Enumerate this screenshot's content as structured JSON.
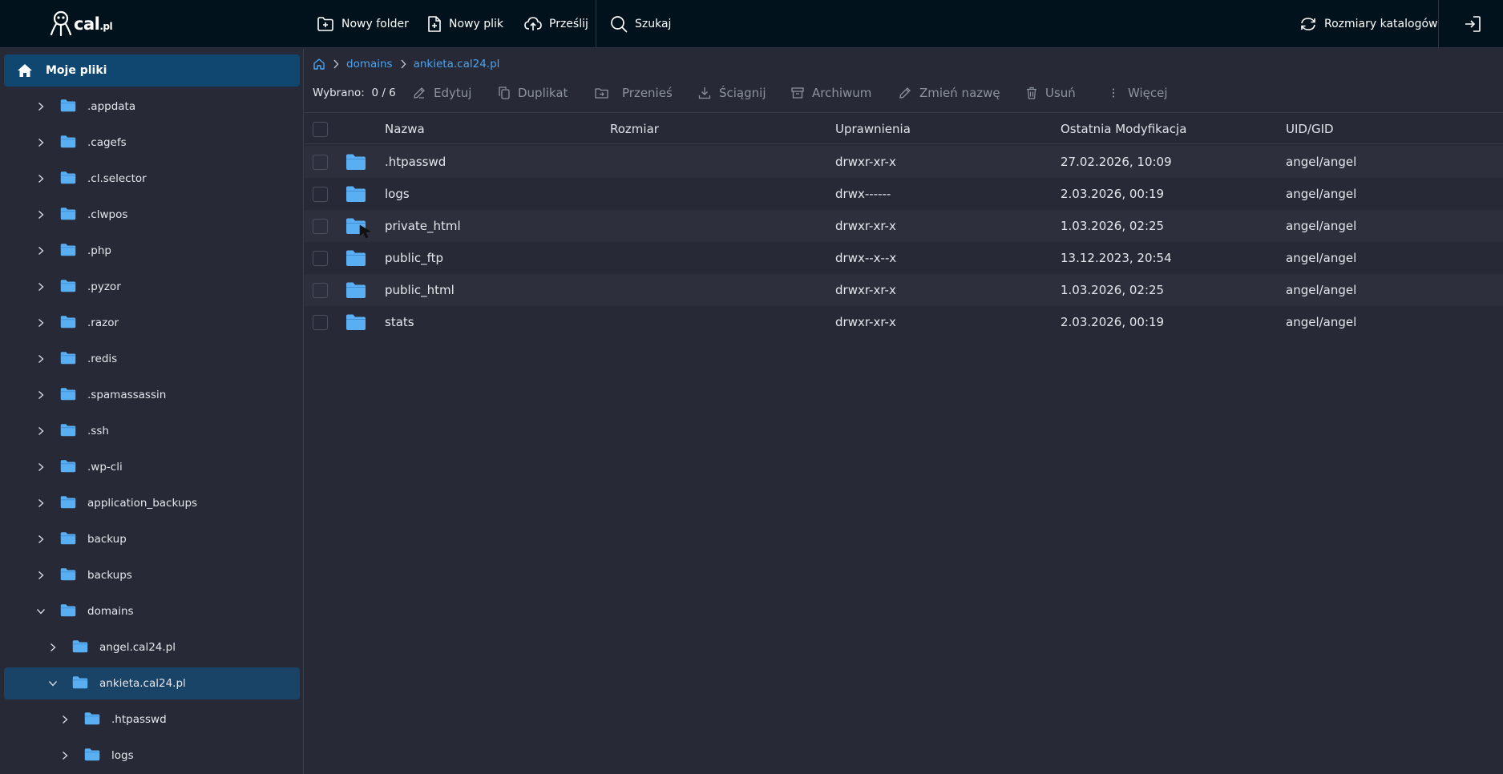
{
  "topbar": {
    "logo_text": "cal",
    "logo_suffix": ".pl",
    "new_folder": "Nowy folder",
    "new_file": "Nowy plik",
    "upload": "Prześlij",
    "search": "Szukaj",
    "dir_sizes": "Rozmiary katalogów"
  },
  "sidebar": {
    "root": "Moje pliki",
    "items": [
      {
        "label": ".appdata",
        "level": 0,
        "expanded": false
      },
      {
        "label": ".cagefs",
        "level": 0,
        "expanded": false
      },
      {
        "label": ".cl.selector",
        "level": 0,
        "expanded": false
      },
      {
        "label": ".clwpos",
        "level": 0,
        "expanded": false
      },
      {
        "label": ".php",
        "level": 0,
        "expanded": false
      },
      {
        "label": ".pyzor",
        "level": 0,
        "expanded": false
      },
      {
        "label": ".razor",
        "level": 0,
        "expanded": false
      },
      {
        "label": ".redis",
        "level": 0,
        "expanded": false
      },
      {
        "label": ".spamassassin",
        "level": 0,
        "expanded": false
      },
      {
        "label": ".ssh",
        "level": 0,
        "expanded": false
      },
      {
        "label": ".wp-cli",
        "level": 0,
        "expanded": false
      },
      {
        "label": "application_backups",
        "level": 0,
        "expanded": false
      },
      {
        "label": "backup",
        "level": 0,
        "expanded": false
      },
      {
        "label": "backups",
        "level": 0,
        "expanded": false
      },
      {
        "label": "domains",
        "level": 0,
        "expanded": true
      },
      {
        "label": "angel.cal24.pl",
        "level": 1,
        "expanded": false
      },
      {
        "label": "ankieta.cal24.pl",
        "level": 1,
        "expanded": true,
        "active": true
      },
      {
        "label": ".htpasswd",
        "level": 2,
        "expanded": false
      },
      {
        "label": "logs",
        "level": 2,
        "expanded": false
      }
    ]
  },
  "breadcrumb": [
    "domains",
    "ankieta.cal24.pl"
  ],
  "actions": {
    "selected_label": "Wybrano:",
    "selected_value": "0 / 6",
    "edit": "Edytuj",
    "duplicate": "Duplikat",
    "move": "Przenieś",
    "download": "Ściągnij",
    "archive": "Archiwum",
    "rename": "Zmień nazwę",
    "delete": "Usuń",
    "more": "Więcej"
  },
  "table": {
    "columns": [
      "Nazwa",
      "Rozmiar",
      "Uprawnienia",
      "Ostatnia Modyfikacja",
      "UID/GID"
    ],
    "rows": [
      {
        "name": ".htpasswd",
        "size": "",
        "perms": "drwxr-xr-x",
        "modified": "27.02.2026, 10:09",
        "uid": "angel/angel"
      },
      {
        "name": "logs",
        "size": "",
        "perms": "drwx------",
        "modified": "2.03.2026, 00:19",
        "uid": "angel/angel"
      },
      {
        "name": "private_html",
        "size": "",
        "perms": "drwxr-xr-x",
        "modified": "1.03.2026, 02:25",
        "uid": "angel/angel"
      },
      {
        "name": "public_ftp",
        "size": "",
        "perms": "drwx--x--x",
        "modified": "13.12.2023, 20:54",
        "uid": "angel/angel"
      },
      {
        "name": "public_html",
        "size": "",
        "perms": "drwxr-xr-x",
        "modified": "1.03.2026, 02:25",
        "uid": "angel/angel"
      },
      {
        "name": "stats",
        "size": "",
        "perms": "drwxr-xr-x",
        "modified": "2.03.2026, 00:19",
        "uid": "angel/angel"
      }
    ]
  },
  "colors": {
    "accent": "#4ba4f0",
    "folder": "#5aaef2",
    "topbar_bg": "#02121c",
    "active_bg": "#1a4368"
  },
  "icons": {
    "new_folder": "folder-plus-icon",
    "new_file": "file-plus-icon",
    "upload": "cloud-upload-icon",
    "search": "search-icon",
    "dir_sizes": "refresh-icon",
    "logout": "logout-icon",
    "home": "home-icon"
  }
}
